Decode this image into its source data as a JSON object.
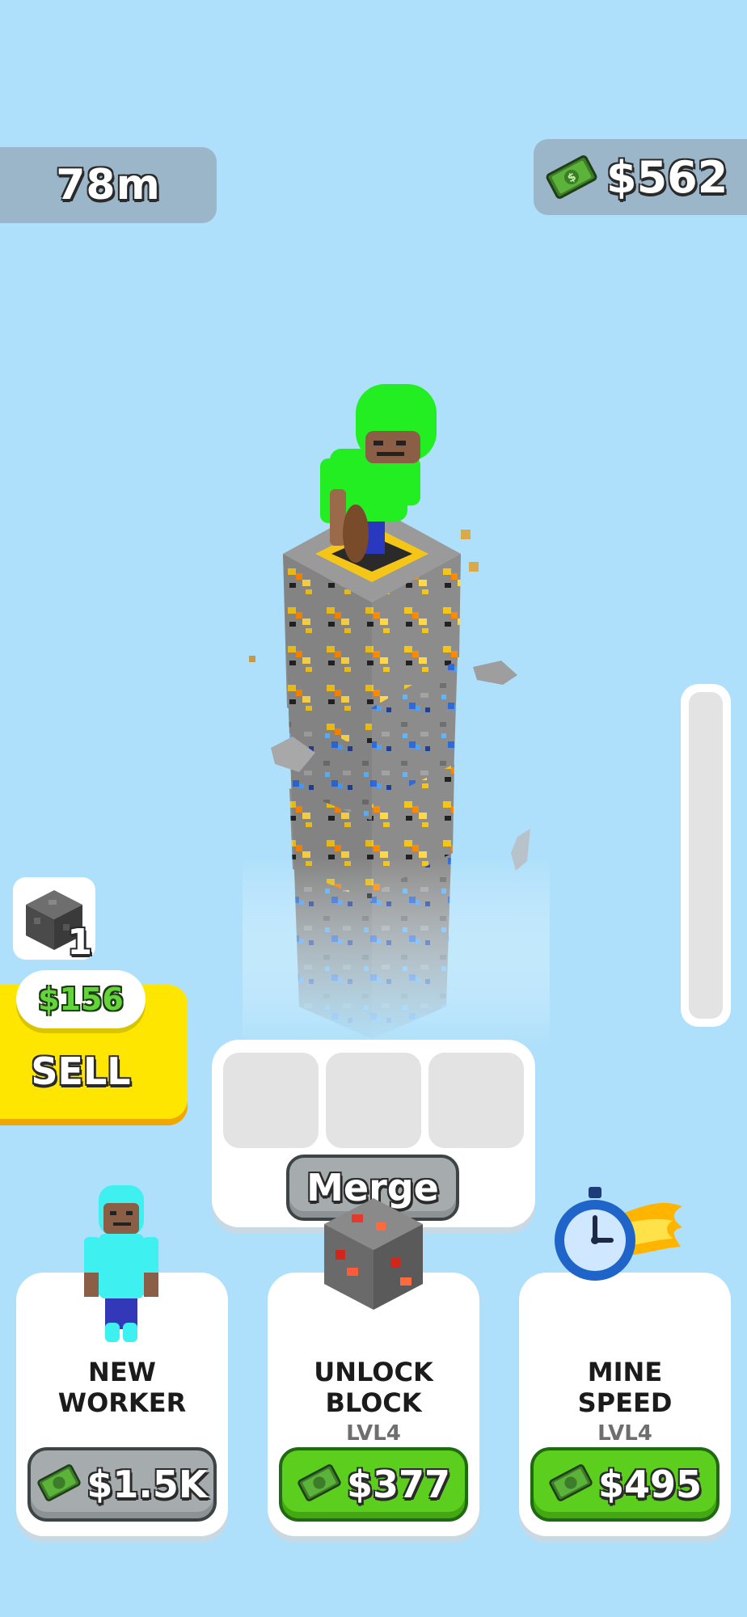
{
  "hud": {
    "depth": "78m",
    "money": "$562"
  },
  "progress": {
    "fill_fraction": 0.0
  },
  "inventory": {
    "count": "1"
  },
  "sell": {
    "price": "$156",
    "label": "SELL"
  },
  "merge": {
    "label": "Merge"
  },
  "cards": [
    {
      "title_line1": "NEW",
      "title_line2": "WORKER",
      "level": "",
      "price": "$1.5K",
      "state": "gray"
    },
    {
      "title_line1": "UNLOCK",
      "title_line2": "BLOCK",
      "level": "LVL4",
      "price": "$377",
      "state": "green"
    },
    {
      "title_line1": "MINE",
      "title_line2": "SPEED",
      "level": "LVL4",
      "price": "$495",
      "state": "green"
    }
  ],
  "colors": {
    "sky": "#aee0fb",
    "button_green": "#5cce1d",
    "sell_yellow": "#ffe600",
    "worker_green": "#22ee22",
    "worker_cyan": "#3ef0ef"
  },
  "icons": [
    "cash-icon",
    "stone-block-icon",
    "worker-icon",
    "redstone-block-icon",
    "stopwatch-icon"
  ]
}
